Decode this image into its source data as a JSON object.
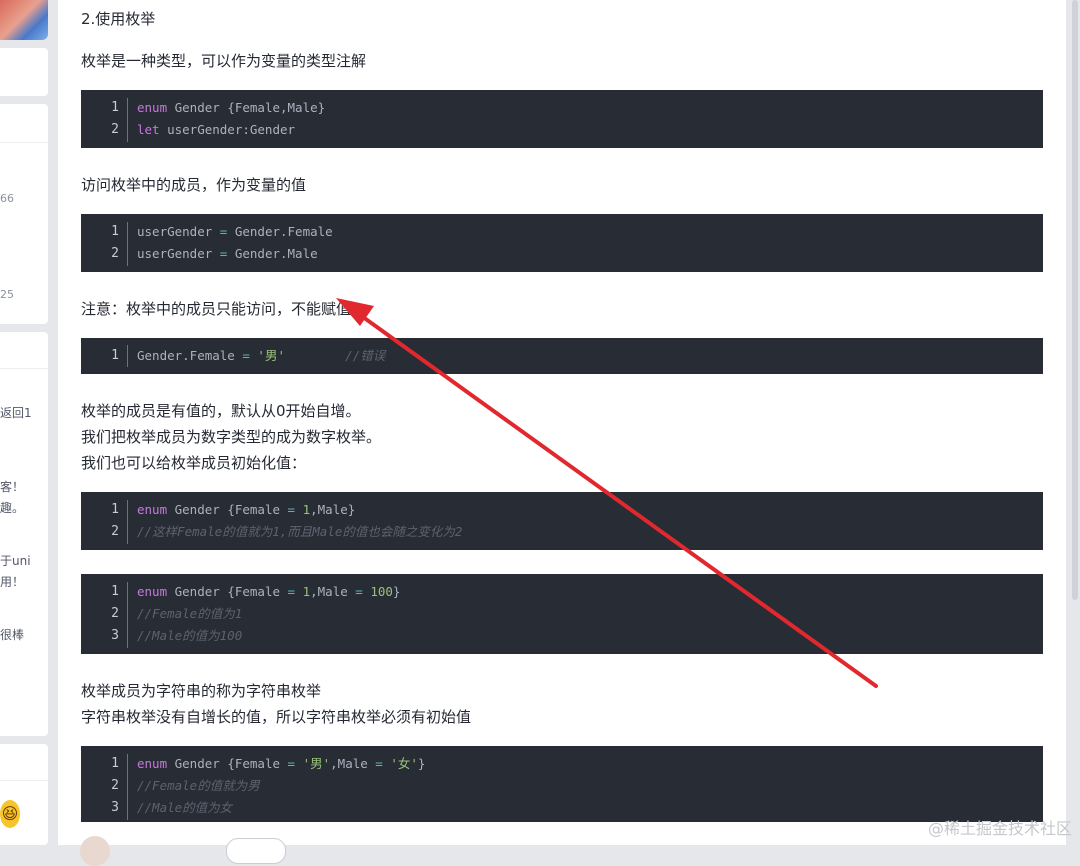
{
  "sidebar": {
    "snippets": [
      "66",
      "25",
      "返回1",
      "客！",
      "趣。",
      "于uni",
      "用！",
      "很棒"
    ],
    "emoji": "😆"
  },
  "article": {
    "heading": "2.使用枚举",
    "para1": "枚举是一种类型，可以作为变量的类型注解",
    "para2": "访问枚举中的成员，作为变量的值",
    "para3": "注意：枚举中的成员只能访问，不能赋值",
    "para4": [
      "枚举的成员是有值的，默认从0开始自增。",
      "我们把枚举成员为数字类型的成为数字枚举。",
      "我们也可以给枚举成员初始化值："
    ],
    "para5": [
      "枚举成员为字符串的称为字符串枚举",
      "字符串枚举没有自增长的值，所以字符串枚举必须有初始值"
    ],
    "code1": {
      "l1": {
        "ln": "1",
        "kw": "enum",
        "rest": " Gender {Female,Male}"
      },
      "l2": {
        "ln": "2",
        "kw": "let",
        "rest": " userGender:Gender"
      }
    },
    "code2": {
      "l1": {
        "ln": "1",
        "a": "userGender ",
        "op": "=",
        "b": " Gender.Female"
      },
      "l2": {
        "ln": "2",
        "a": "userGender ",
        "op": "=",
        "b": " Gender.Male"
      }
    },
    "code3": {
      "l1": {
        "ln": "1",
        "a": "Gender.Female ",
        "op": "=",
        "str": " '男'",
        "cm": "        //错误"
      }
    },
    "code4": {
      "l1": {
        "ln": "1",
        "kw": "enum",
        "a": " Gender {Female ",
        "op": "=",
        "num": " 1",
        "b": ",Male}"
      },
      "l2": {
        "ln": "2",
        "cm": "//这样Female的值就为1,而且Male的值也会随之变化为2"
      }
    },
    "code5": {
      "l1": {
        "ln": "1",
        "kw": "enum",
        "a": " Gender {Female ",
        "op": "=",
        "num": " 1",
        "b": ",Male ",
        "op2": "=",
        "num2": " 100",
        "c": "}"
      },
      "l2": {
        "ln": "2",
        "cm": "//Female的值为1"
      },
      "l3": {
        "ln": "3",
        "cm": "//Male的值为100"
      }
    },
    "code6": {
      "l1": {
        "ln": "1",
        "kw": "enum",
        "a": " Gender {Female ",
        "op": "=",
        "str": " '男'",
        "b": ",Male ",
        "op2": "=",
        "str2": " '女'",
        "c": "}"
      },
      "l2": {
        "ln": "2",
        "cm": "//Female的值就为男"
      },
      "l3": {
        "ln": "3",
        "cm": "//Male的值为女"
      }
    }
  },
  "watermark": "@稀土掘金技术社区",
  "colors": {
    "annotation_arrow": "#e0282e",
    "code_bg": "#282c34"
  }
}
